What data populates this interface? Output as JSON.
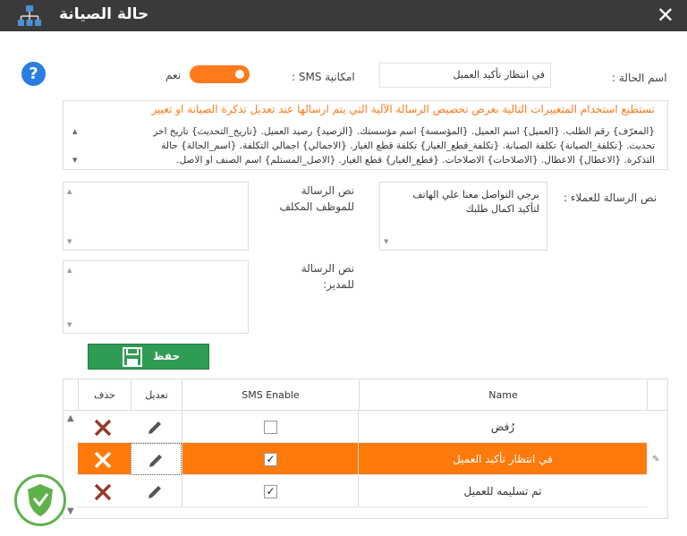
{
  "window": {
    "title": "حالة الصيانة"
  },
  "form": {
    "status_name_label": "اسم الحالة :",
    "status_name_value": "في انتظار تأكيد العميل",
    "sms_option_label": "امكانية SMS :",
    "sms_toggle_label": "نعم"
  },
  "info": {
    "orange_text": "تستطيع استخدام المتغييرات التالية بغرض تخصيص الرسالة الآلية التي  يتم ارسالها عند تعديل تذكرة الصيانة او تغيير",
    "line1": "{المعرّف} رقم الطلب. {العميل} اسم العميل. {المؤسسة} اسم مؤسستك. {الرصيد} رصيد العميل. {تاريخ_التحديث} تاريخ اخر",
    "line2": "تحديث. {تكلفة_الصيانة} تكلفة الصيانة. {تكلفة_قطع_الغيار} تكلفة قطع الغيار. {الاجمالي} اجمالي التكلفة. {اسم_الحالة} حالة",
    "line3": "التذكرة. {الاعطال} الاعطال. {الاصلاحات} الاصلاحات. {قطع_الغيار} قطع الغيار. {الاصل_المستلم} اسم الصنف او الاصل."
  },
  "messages": {
    "customer_label": "نص الرسالة للعملاء :",
    "customer_text": "برجي التواصل معنا علي الهاتف\nلتأكيد اكمال طلبك",
    "employee_label_line1": "نص الرسالة",
    "employee_label_line2": "للموظف المكلف",
    "manager_label_line1": "نص الرسالة",
    "manager_label_line2": "للمدير:"
  },
  "save_button": {
    "label": "حفظ"
  },
  "grid": {
    "headers": {
      "name": "Name",
      "sms": "SMS Enable",
      "edit": "تعديل",
      "delete": "حذف"
    },
    "rows": [
      {
        "name": "رُفض",
        "sms": false
      },
      {
        "name": "في انتظار تأكيد العميل",
        "sms": true
      },
      {
        "name": "تم تسليمه للعميل",
        "sms": true
      }
    ]
  },
  "colors": {
    "accent": "#ff7a0a",
    "save_green": "#2e9c52",
    "help_blue": "#2a7de1",
    "titlebar": "#3a3a3a"
  }
}
